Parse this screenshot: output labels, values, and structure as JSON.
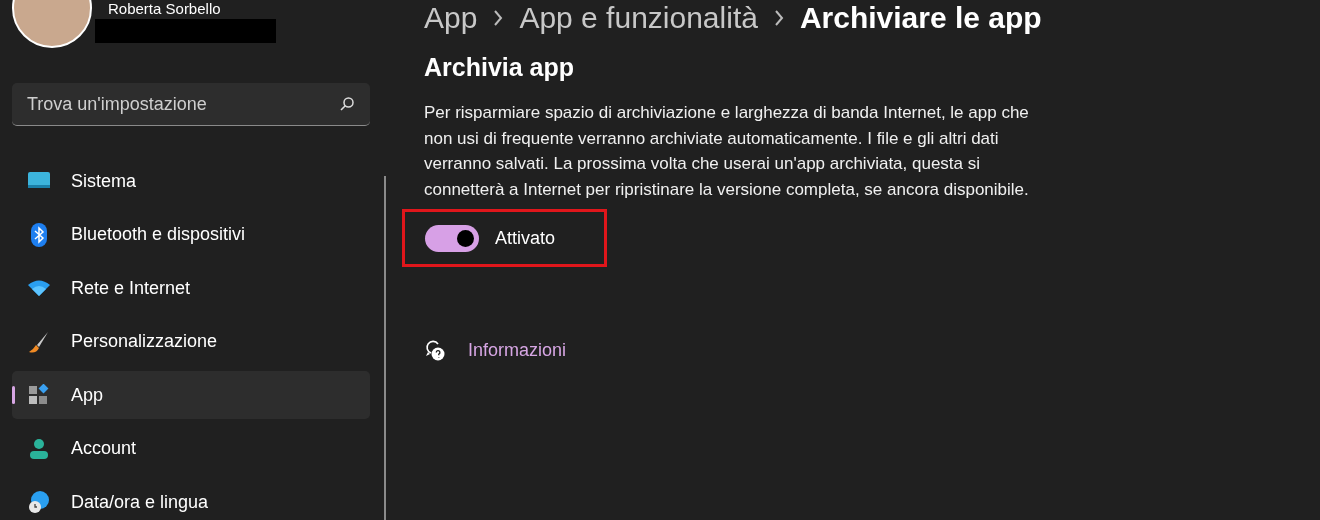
{
  "user": {
    "name": "Roberta Sorbello"
  },
  "search": {
    "placeholder": "Trova un'impostazione"
  },
  "sidebar": {
    "items": [
      {
        "label": "Sistema",
        "kind": "monitor",
        "selected": false
      },
      {
        "label": "Bluetooth e dispositivi",
        "kind": "bluetooth",
        "selected": false
      },
      {
        "label": "Rete e Internet",
        "kind": "wifi",
        "selected": false
      },
      {
        "label": "Personalizzazione",
        "kind": "brush",
        "selected": false
      },
      {
        "label": "App",
        "kind": "apps",
        "selected": true
      },
      {
        "label": "Account",
        "kind": "person",
        "selected": false
      },
      {
        "label": "Data/ora e lingua",
        "kind": "globe",
        "selected": false
      }
    ]
  },
  "breadcrumb": [
    "App",
    "App e funzionalità",
    "Archiviare le app"
  ],
  "section": {
    "title": "Archivia app",
    "description": "Per risparmiare spazio di archiviazione e larghezza di banda Internet, le app che non usi di frequente verranno archiviate automaticamente. I file e gli altri dati verranno salvati. La prossima volta che userai un'app archiviata, questa si connetterà a Internet per ripristinare la versione completa, se ancora disponibile."
  },
  "toggle": {
    "on": true,
    "label": "Attivato",
    "highlighted": true
  },
  "help_link": {
    "label": "Informazioni"
  }
}
